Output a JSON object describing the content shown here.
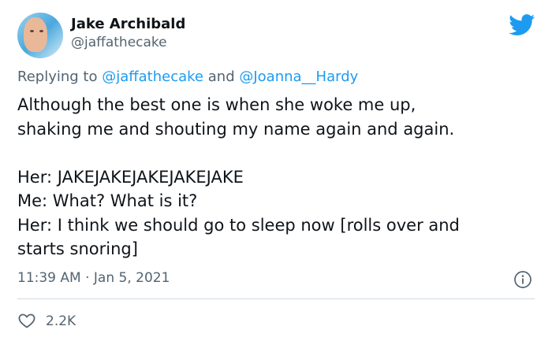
{
  "author": {
    "name": "Jake Archibald",
    "handle": "@jaffathecake"
  },
  "reply": {
    "prefix": "Replying to",
    "mention1": "@jaffathecake",
    "joiner": "and",
    "mention2": "@Joanna__Hardy"
  },
  "tweet": {
    "lines": [
      "Although the best one is when she woke me up,",
      "shaking me and shouting my name again and again.",
      "Her: JAKEJAKEJAKEJAKEJAKE",
      "Me: What? What is it?",
      "Her: I think we should go to sleep now [rolls over and",
      "starts snoring]"
    ]
  },
  "meta": {
    "timestamp": "11:39 AM · Jan 5, 2021",
    "likes": "2.2K"
  },
  "icons": {
    "brand": "twitter-bird-icon",
    "info": "info-icon",
    "like": "heart-icon"
  },
  "colors": {
    "brand": "#1d9bf0",
    "muted": "#536471",
    "text": "#0f1419",
    "divider": "#cfd9de"
  }
}
